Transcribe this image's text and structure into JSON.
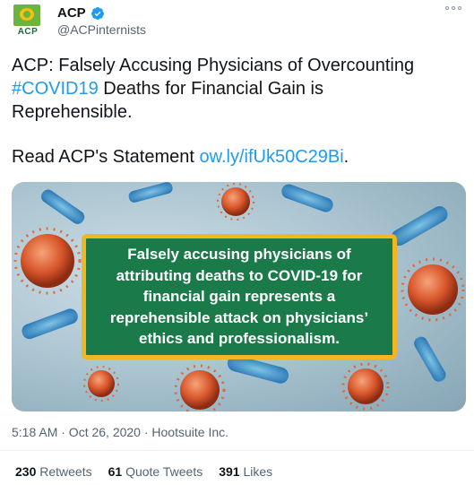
{
  "author": {
    "logo_text": "ACP",
    "name": "ACP",
    "handle": "@ACPinternists",
    "verified": true
  },
  "tweet": {
    "line1": "ACP: Falsely Accusing Physicians of Overcounting",
    "hashtag": "#COVID19",
    "line2_rest": " Deaths for Financial Gain is",
    "line3": "Reprehensible.",
    "read_prefix": "Read ACP's Statement ",
    "link": "ow.ly/ifUk50C29Bi",
    "link_suffix": "."
  },
  "media": {
    "quote_line1": "Falsely accusing physicians of",
    "quote_line2": "attributing deaths to COVID-19 for",
    "quote_line3": "financial gain represents a",
    "quote_line4": "reprehensible attack on physicians’",
    "quote_line5": "ethics and professionalism.",
    "accent_color": "#f0b722",
    "box_color": "#1b7a4a"
  },
  "meta": {
    "timestamp": "5:18 AM · Oct 26, 2020 · Hootsuite Inc."
  },
  "stats": {
    "retweets_count": "230",
    "retweets_label": "Retweets",
    "quotes_count": "61",
    "quotes_label": "Quote Tweets",
    "likes_count": "391",
    "likes_label": "Likes"
  }
}
